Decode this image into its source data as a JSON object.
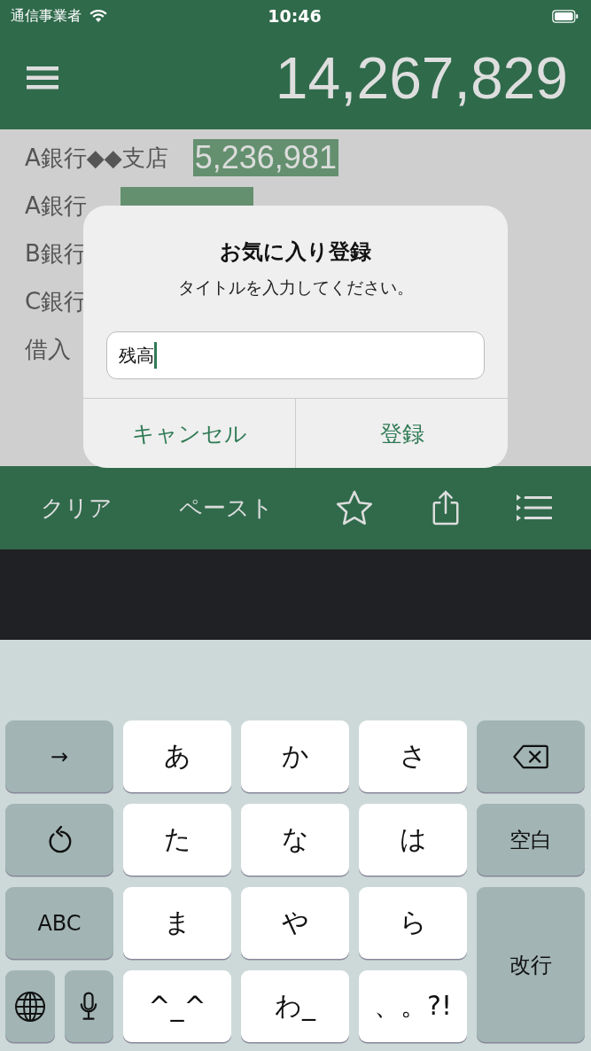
{
  "status_bar": {
    "carrier": "通信事業者",
    "time": "10:46"
  },
  "header": {
    "total": "14,267,829"
  },
  "accounts": [
    {
      "kind": "amount",
      "name": "A銀行◆◆支店",
      "value": "5,236,981"
    },
    {
      "kind": "covered",
      "name": "A銀行"
    },
    {
      "kind": "plain",
      "name": "B銀行"
    },
    {
      "kind": "plain",
      "name": "C銀行"
    },
    {
      "kind": "plain",
      "name": "借入"
    }
  ],
  "dialog": {
    "title": "お気に入り登録",
    "message": "タイトルを入力してください。",
    "input_value": "残高",
    "buttons": [
      "キャンセル",
      "登録"
    ]
  },
  "toolbar": [
    {
      "kind": "text",
      "label": "クリア"
    },
    {
      "kind": "text",
      "label": "ペースト"
    },
    {
      "kind": "star"
    },
    {
      "kind": "share"
    },
    {
      "kind": "list"
    }
  ],
  "keyboard": [
    {
      "kind": "gray",
      "label": "→"
    },
    {
      "kind": "white",
      "label": "あ"
    },
    {
      "kind": "white",
      "label": "か"
    },
    {
      "kind": "white",
      "label": "さ"
    },
    {
      "kind": "backspace"
    },
    {
      "kind": "undo"
    },
    {
      "kind": "white",
      "label": "た"
    },
    {
      "kind": "white",
      "label": "な"
    },
    {
      "kind": "white",
      "label": "は"
    },
    {
      "kind": "gray",
      "label": "空白"
    },
    {
      "kind": "gray",
      "label": "ABC"
    },
    {
      "kind": "white",
      "label": "ま"
    },
    {
      "kind": "white",
      "label": "や"
    },
    {
      "kind": "white",
      "label": "ら"
    },
    {
      "kind": "return",
      "label": "改行"
    },
    {
      "kind": "globe"
    },
    {
      "kind": "mic"
    },
    {
      "kind": "white",
      "label": "^_^"
    },
    {
      "kind": "white",
      "label": "わ_"
    },
    {
      "kind": "white",
      "label": "、。?!"
    }
  ]
}
